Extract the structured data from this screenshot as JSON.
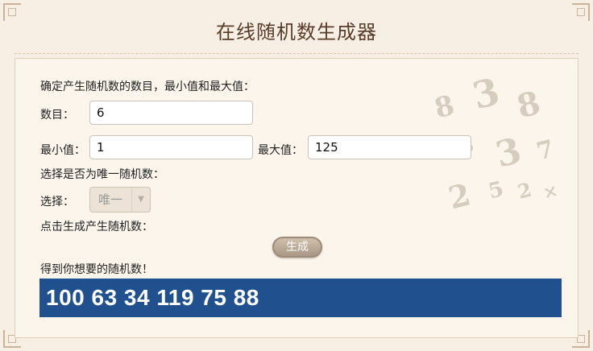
{
  "title": "在线随机数生成器",
  "form": {
    "instruction": "确定产生随机数的数目，最小值和最大值：",
    "count_label": "数目：",
    "count_value": "6",
    "min_label": "最小值：",
    "min_value": "1",
    "max_label": "最大值：",
    "max_value": "125",
    "unique_prompt": "选择是否为唯一随机数：",
    "select_label": "选择：",
    "select_value": "唯一",
    "generate_prompt": "点击生成产生随机数：",
    "generate_button": "生成",
    "result_label": "得到你想要的随机数！",
    "result_value": "100 63 34 119 75 88"
  },
  "colors": {
    "background": "#f7efe3",
    "title": "#5a3c2a",
    "result_bg": "#21508f",
    "button": "#a99783"
  },
  "icons": {
    "select_arrow": "chevron-down-icon"
  }
}
